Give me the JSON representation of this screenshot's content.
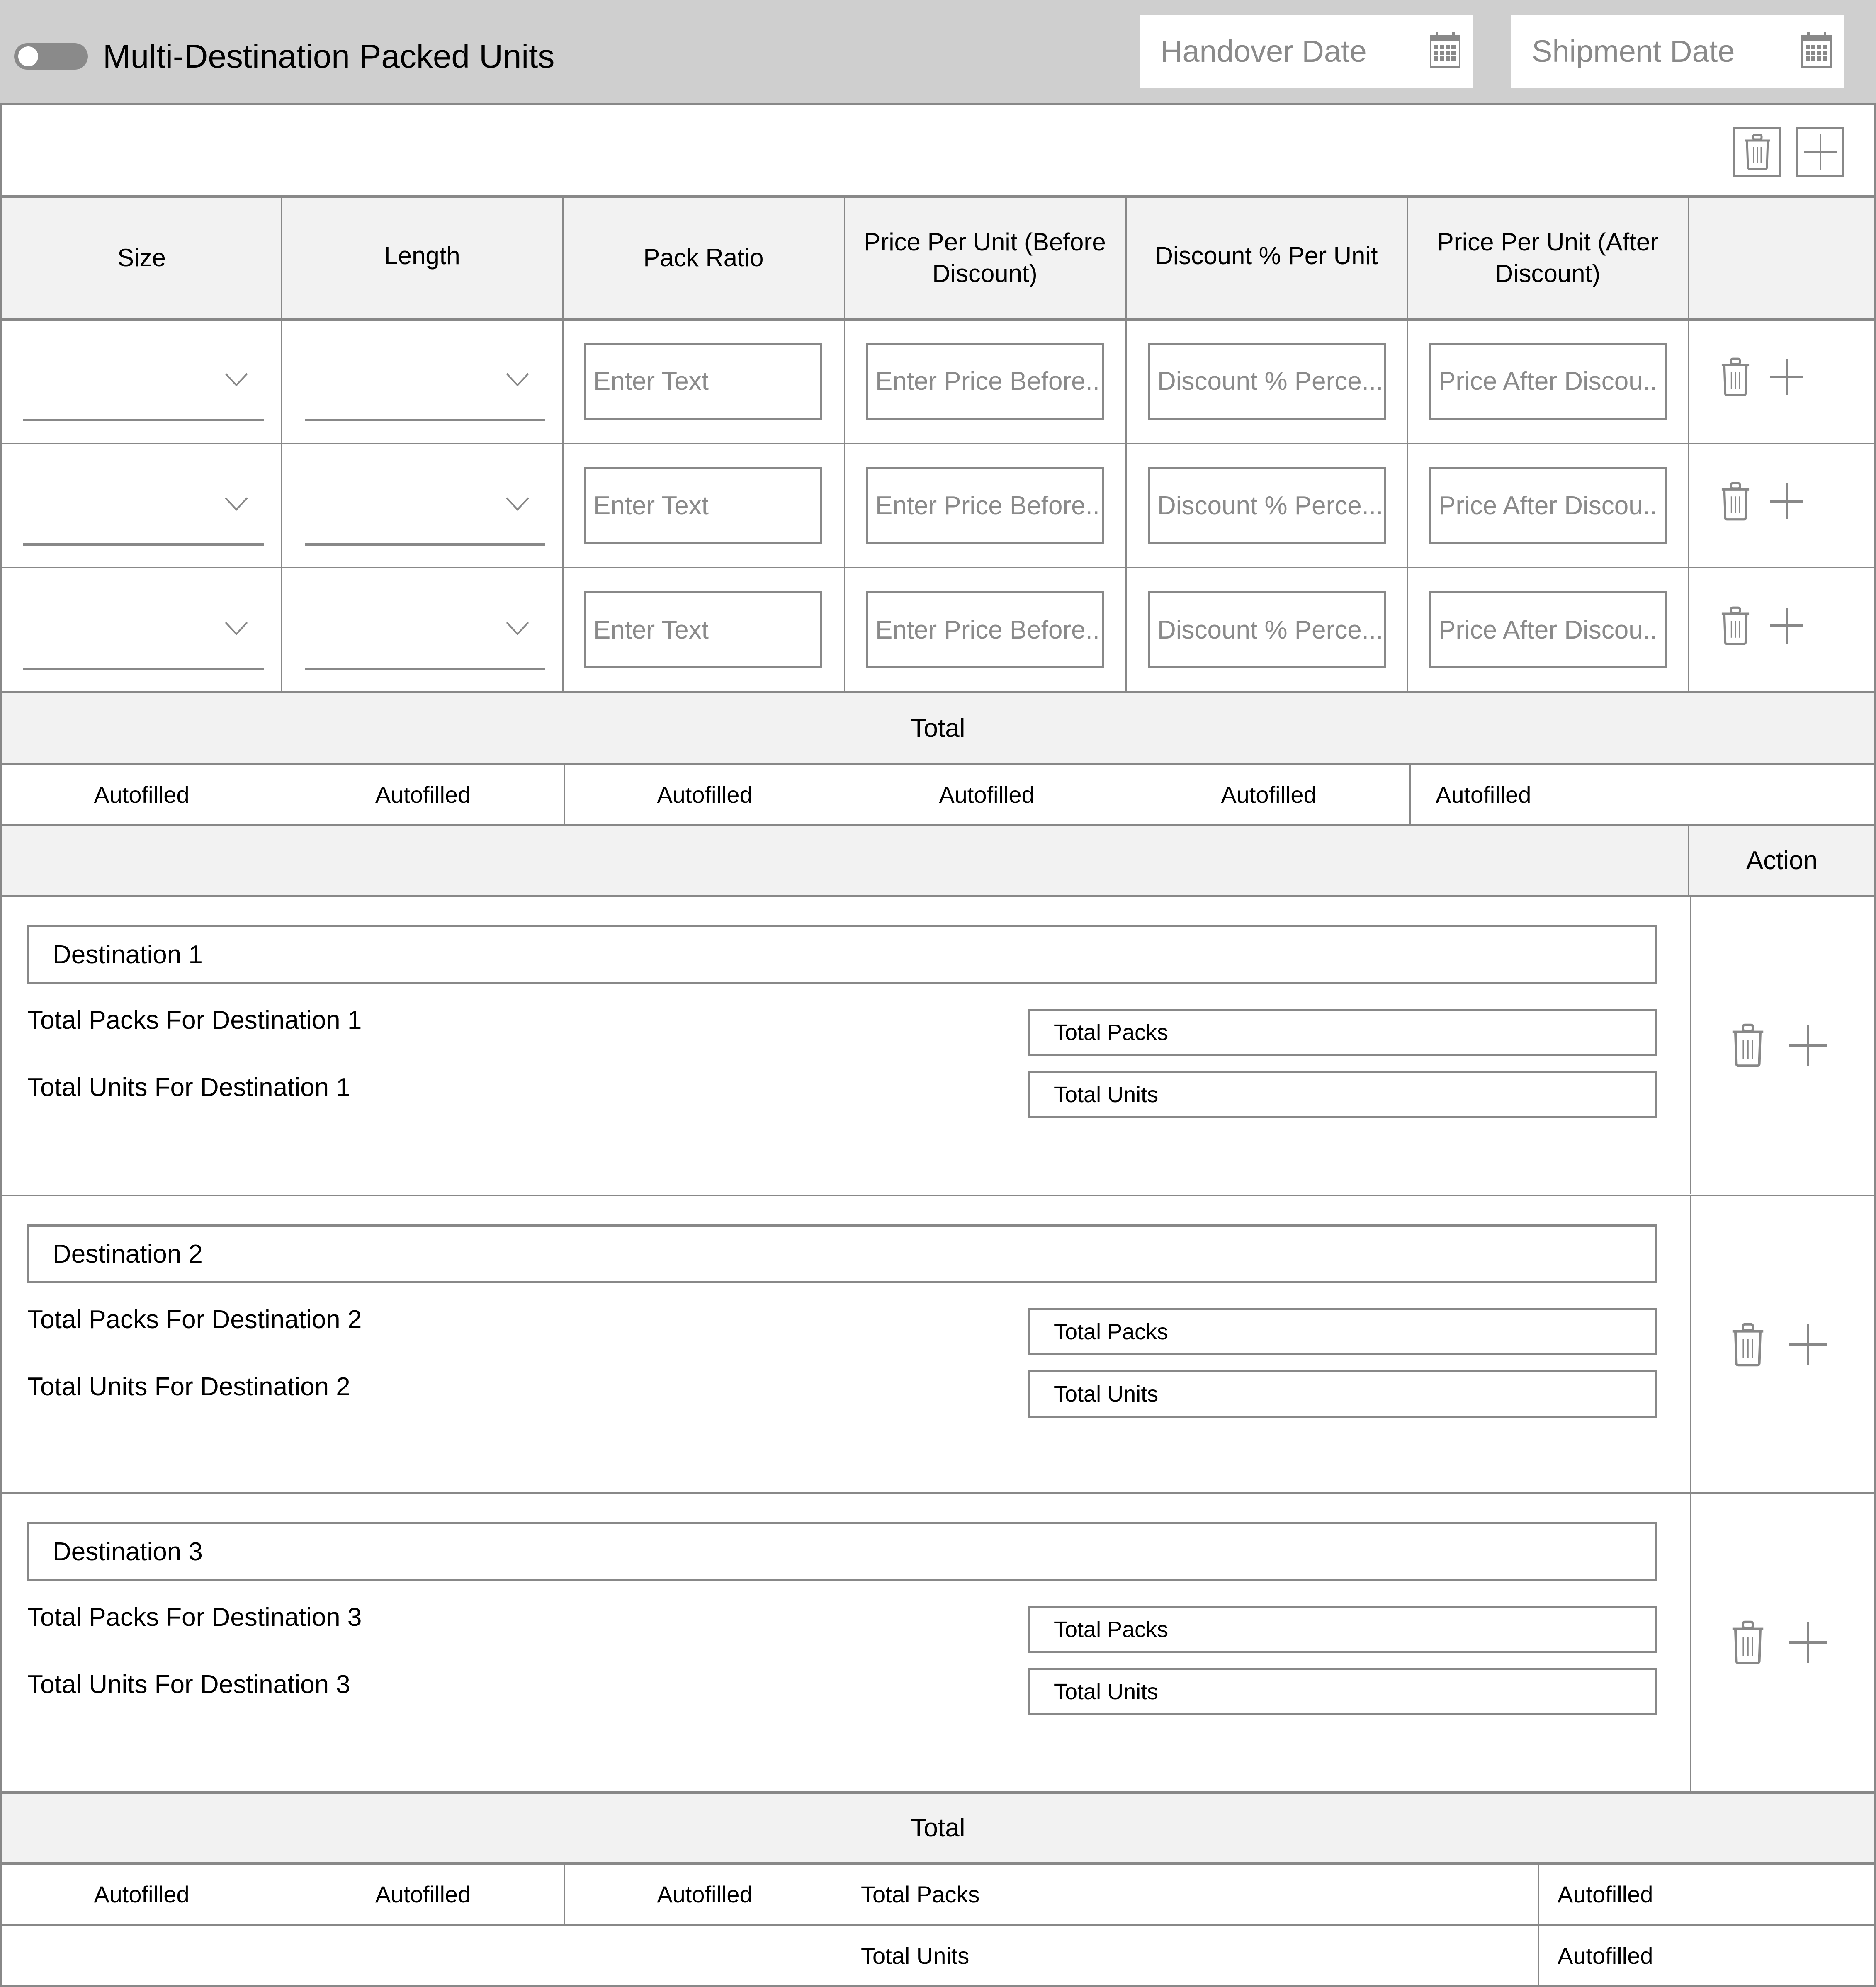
{
  "header": {
    "toggle_state": "off",
    "title": "Multi-Destination Packed Units",
    "handover_date": {
      "placeholder": "Handover Date",
      "icon": "calendar-icon"
    },
    "shipment_date": {
      "placeholder": "Shipment Date",
      "icon": "calendar-icon"
    }
  },
  "toolbar": {
    "delete_icon": "trash-icon",
    "add_icon": "plus-icon"
  },
  "table": {
    "columns": [
      "Size",
      "Length",
      "Pack Ratio",
      "Price Per Unit (Before Discount)",
      "Discount % Per Unit",
      "Price Per Unit (After Discount)",
      ""
    ],
    "rows": [
      {
        "size": "",
        "length": "",
        "pack_ratio_placeholder": "Enter Text",
        "price_before_placeholder": "Enter Price Before..",
        "discount_placeholder": "Discount % Perce...",
        "price_after_placeholder": "Price After Discou.."
      },
      {
        "size": "",
        "length": "",
        "pack_ratio_placeholder": "Enter Text",
        "price_before_placeholder": "Enter Price Before..",
        "discount_placeholder": "Discount % Perce...",
        "price_after_placeholder": "Price After Discou.."
      },
      {
        "size": "",
        "length": "",
        "pack_ratio_placeholder": "Enter Text",
        "price_before_placeholder": "Enter Price Before..",
        "discount_placeholder": "Discount % Perce...",
        "price_after_placeholder": "Price After Discou.."
      }
    ],
    "total_label": "Total",
    "totals": [
      "Autofilled",
      "Autofilled",
      "Autofilled",
      "Autofilled",
      "Autofilled",
      "Autofilled"
    ]
  },
  "destinations": {
    "action_header": "Action",
    "items": [
      {
        "name": "Destination 1",
        "packs_label": "Total Packs For Destination 1",
        "packs_value": "Total Packs",
        "units_label": "Total Units For Destination 1",
        "units_value": "Total Units"
      },
      {
        "name": "Destination 2",
        "packs_label": "Total Packs For Destination 2",
        "packs_value": "Total Packs",
        "units_label": "Total Units For Destination 2",
        "units_value": "Total Units"
      },
      {
        "name": "Destination 3",
        "packs_label": "Total Packs For Destination 3",
        "packs_value": "Total Packs",
        "units_label": "Total Units For Destination 3",
        "units_value": "Total Units"
      }
    ],
    "total_label": "Total",
    "totals_row1": [
      "Autofilled",
      "Autofilled",
      "Autofilled"
    ],
    "total_packs_label": "Total Packs",
    "total_packs_value": "Autofilled",
    "total_units_label": "Total Units",
    "total_units_value": "Autofilled"
  },
  "colors": {
    "header_bg": "#cfcfcf",
    "border": "#888888",
    "gray_row": "#f2f2f2",
    "placeholder": "#8a8a8a"
  }
}
